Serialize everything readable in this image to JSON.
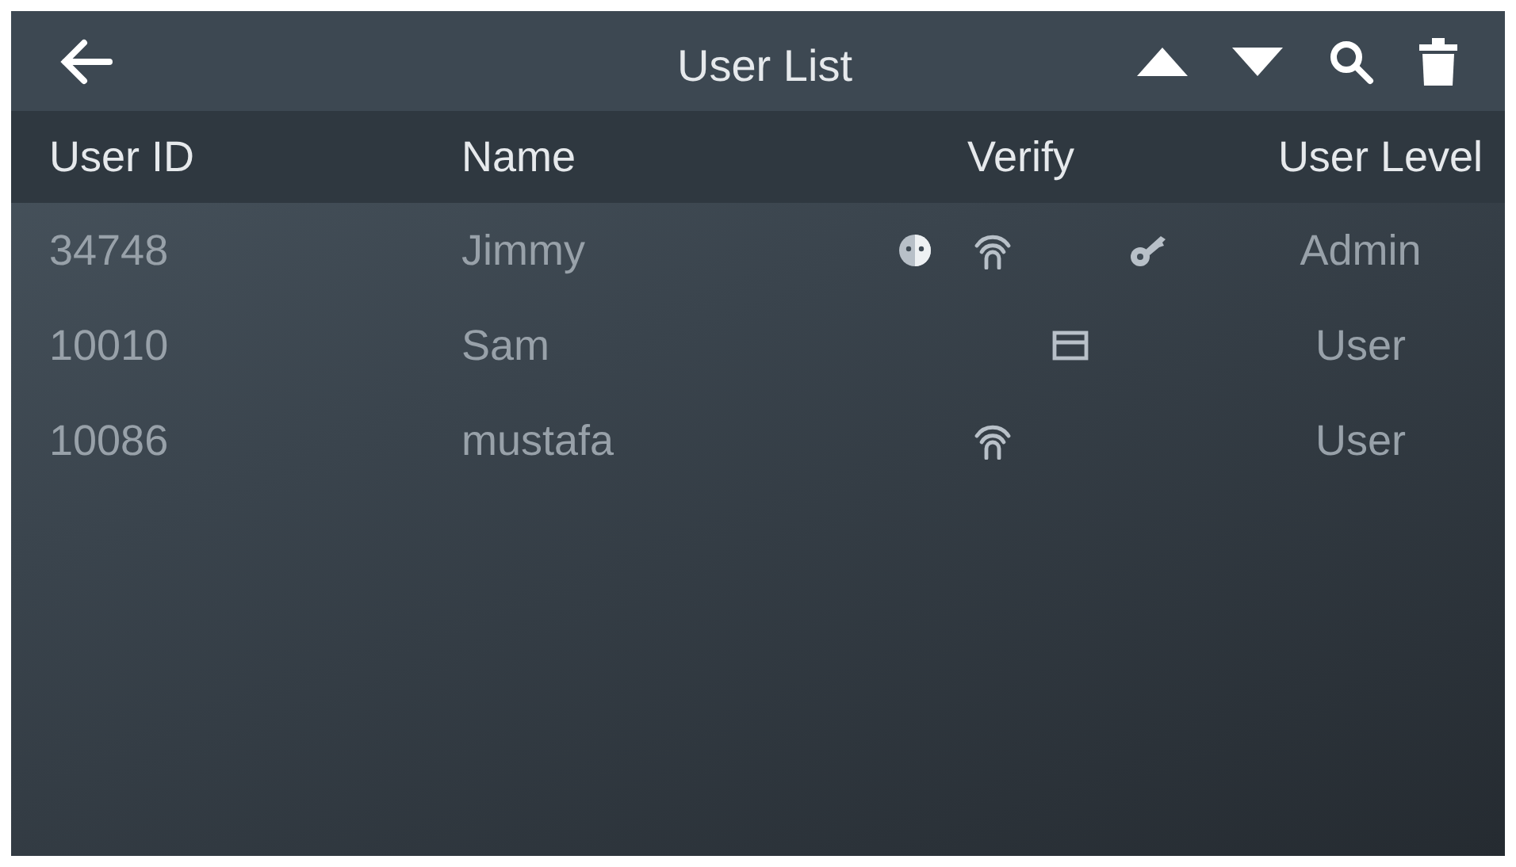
{
  "title": "User List",
  "columns": [
    "User ID",
    "Name",
    "Verify",
    "User Level"
  ],
  "rows": [
    {
      "user_id": "34748",
      "name": "Jimmy",
      "verify": [
        {
          "kind": "face"
        },
        {
          "kind": "fingerprint"
        },
        {
          "kind": "password"
        }
      ],
      "level": "Admin"
    },
    {
      "user_id": "10010",
      "name": "Sam",
      "verify": [
        {
          "kind": "card"
        }
      ],
      "level": "User"
    },
    {
      "user_id": "10086",
      "name": "mustafa",
      "verify": [
        {
          "kind": "fingerprint"
        }
      ],
      "level": "User"
    }
  ]
}
